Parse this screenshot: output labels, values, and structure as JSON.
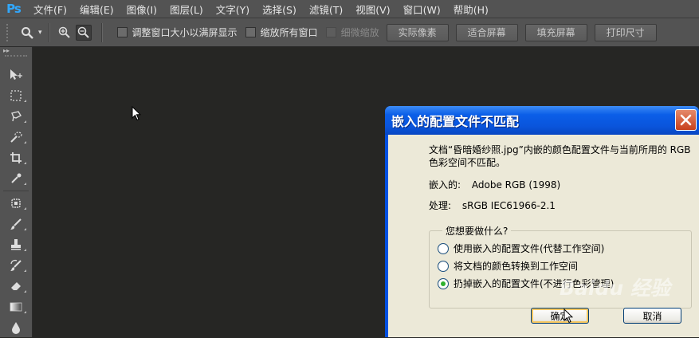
{
  "app": {
    "logo": "Ps"
  },
  "menu": [
    "文件(F)",
    "编辑(E)",
    "图像(I)",
    "图层(L)",
    "文字(Y)",
    "选择(S)",
    "滤镜(T)",
    "视图(V)",
    "窗口(W)",
    "帮助(H)"
  ],
  "options": {
    "resize_windows": "调整窗口大小以满屏显示",
    "zoom_all_windows": "缩放所有窗口",
    "scrubby_zoom": "细微缩放",
    "buttons": [
      "实际像素",
      "适合屏幕",
      "填充屏幕",
      "打印尺寸"
    ]
  },
  "dialog": {
    "title": "嵌入的配置文件不匹配",
    "message": "文档“昏暗婚纱照.jpg”内嵌的颜色配置文件与当前所用的 RGB 色彩空间不匹配。",
    "embedded_label": "嵌入的:",
    "embedded_value": "Adobe RGB (1998)",
    "working_label": "处理:",
    "working_value": "sRGB IEC61966-2.1",
    "question": "您想要做什么?",
    "options": [
      "使用嵌入的配置文件(代替工作空间)",
      "将文档的颜色转换到工作空间",
      "扔掉嵌入的配置文件(不进行色彩管理)"
    ],
    "selected_option": 2,
    "ok": "确定",
    "cancel": "取消"
  },
  "watermark": "Baidu 经验",
  "colors": {
    "accent": "#31a8ff",
    "xp_title": "#0a55dc",
    "dialog_bg": "#ece9d8",
    "canvas": "#262624"
  }
}
